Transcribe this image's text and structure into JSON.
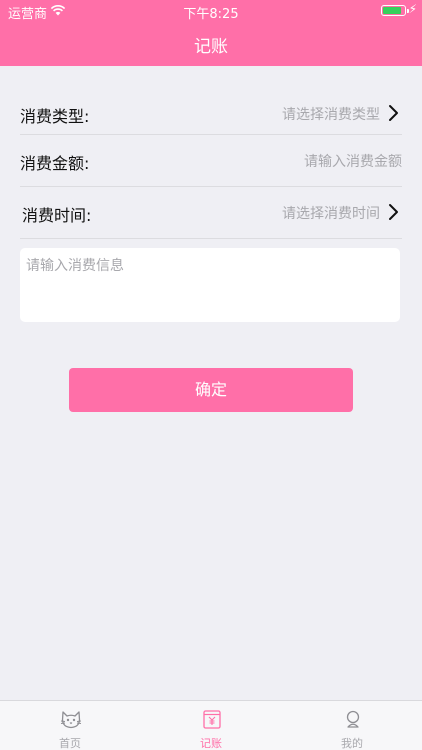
{
  "status_bar": {
    "carrier": "运营商",
    "time": "下午8:25"
  },
  "nav": {
    "title": "记账"
  },
  "form": {
    "type_label": "消费类型:",
    "type_placeholder": "请选择消费类型",
    "amount_label": "消费金额:",
    "amount_placeholder": "请输入消费金额",
    "time_label": "消费时间:",
    "time_placeholder": "请选择消费时间",
    "info_placeholder": "请输入消费信息"
  },
  "confirm_label": "确定",
  "tabs": [
    {
      "label": "首页",
      "icon": "cat-icon",
      "active": false
    },
    {
      "label": "记账",
      "icon": "ledger-icon",
      "active": true
    },
    {
      "label": "我的",
      "icon": "profile-icon",
      "active": false
    }
  ],
  "colors": {
    "accent": "#ff6fa8",
    "background": "#efeff4",
    "placeholder": "#a8a8ad"
  }
}
